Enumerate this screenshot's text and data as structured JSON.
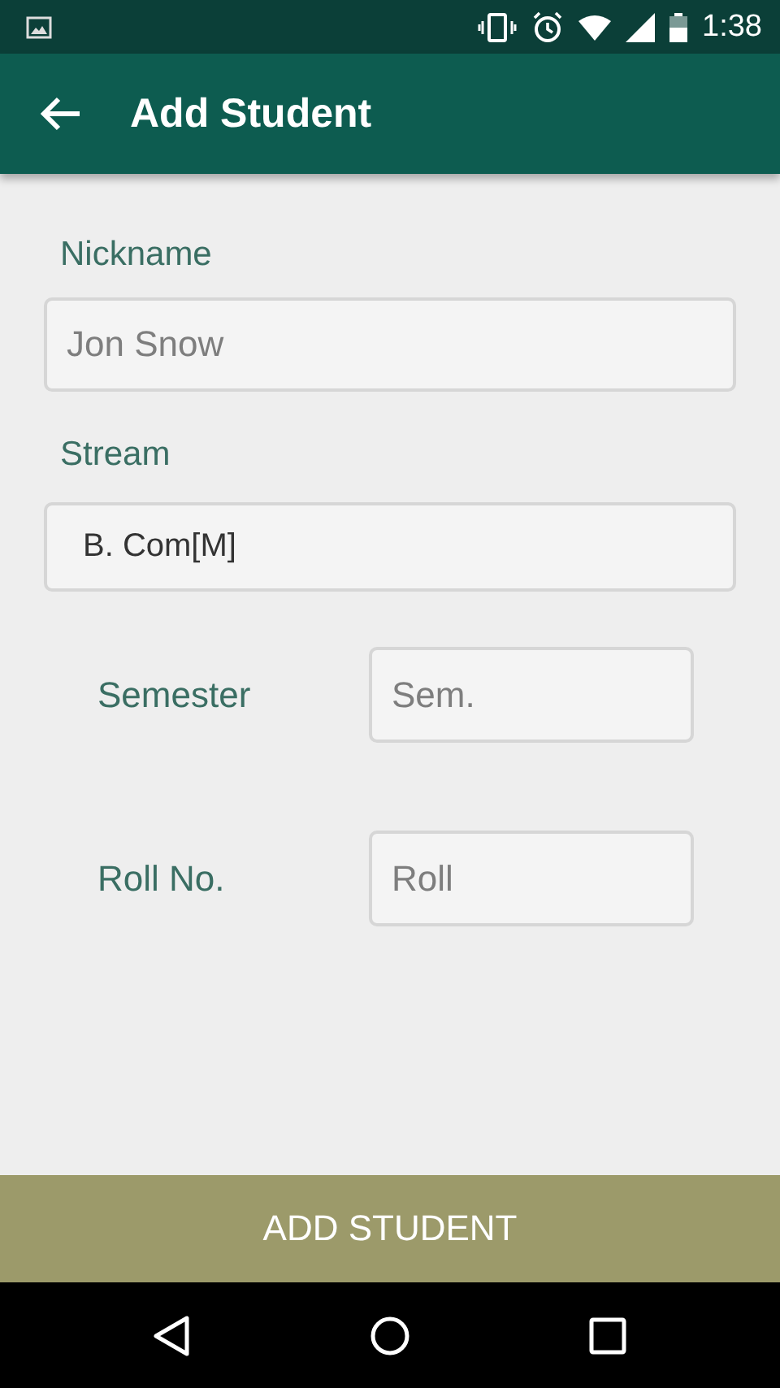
{
  "status_bar": {
    "time": "1:38"
  },
  "app_bar": {
    "title": "Add Student"
  },
  "form": {
    "nickname": {
      "label": "Nickname",
      "placeholder": "Jon Snow"
    },
    "stream": {
      "label": "Stream",
      "value": "B. Com[M]"
    },
    "semester": {
      "label": "Semester",
      "placeholder": "Sem."
    },
    "roll": {
      "label": "Roll No.",
      "placeholder": "Roll"
    }
  },
  "submit_button": {
    "label": "ADD STUDENT"
  }
}
